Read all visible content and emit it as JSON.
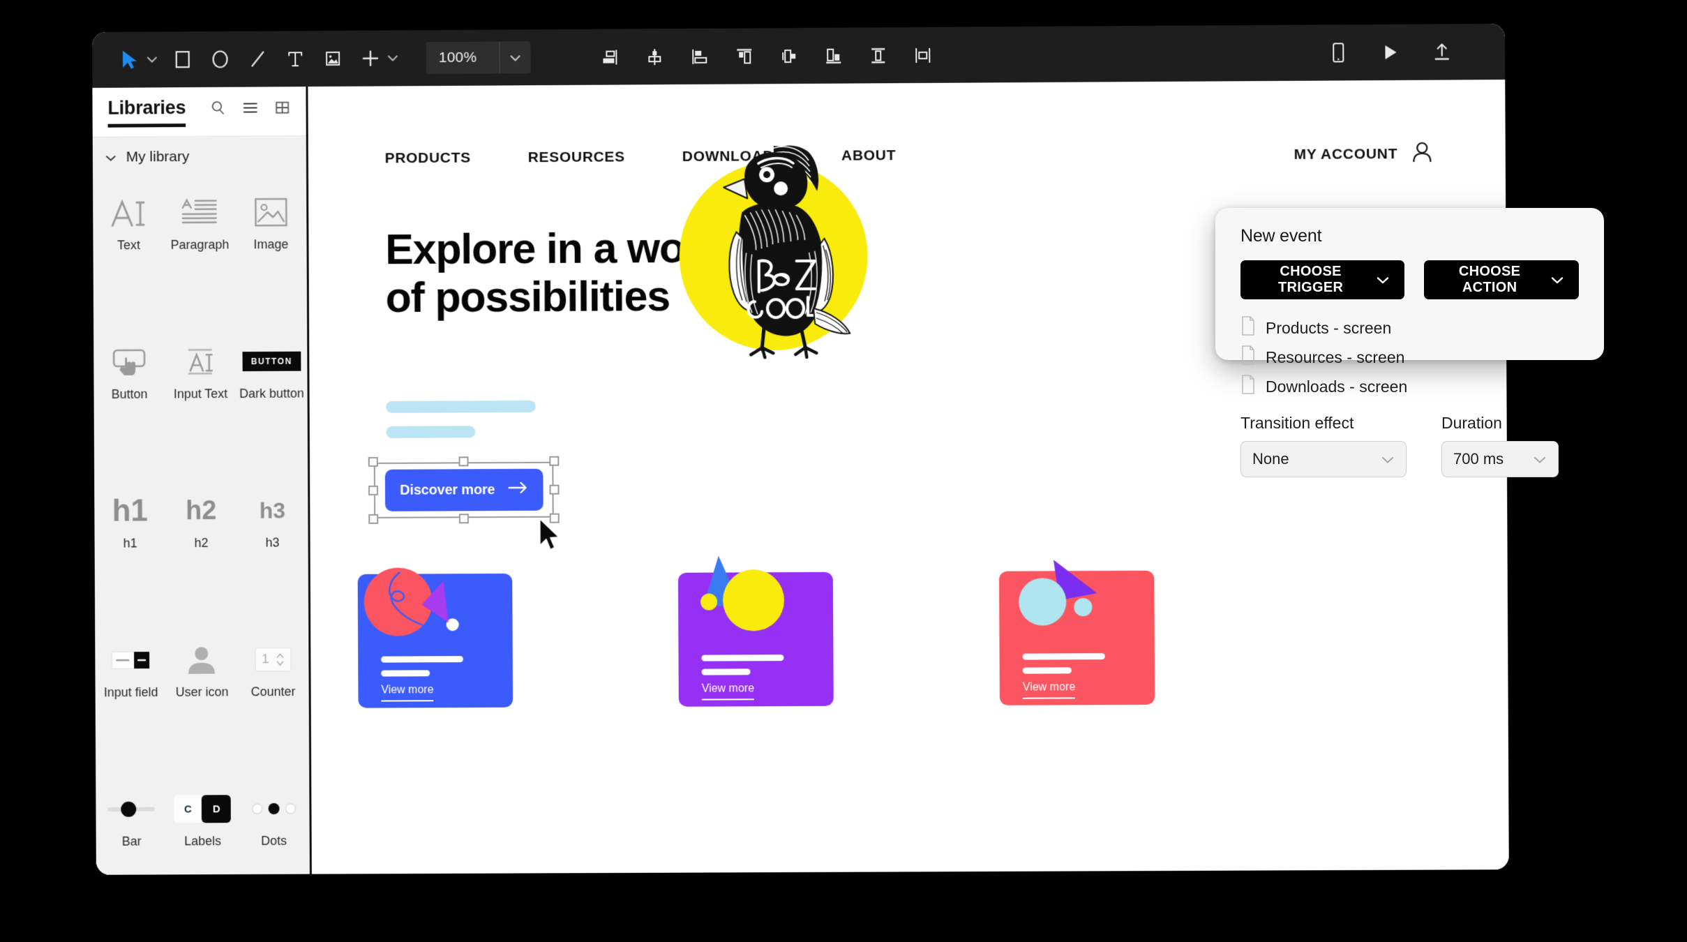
{
  "toolbar": {
    "tools": [
      {
        "name": "select-tool",
        "icon": "cursor-arrow-icon",
        "has_chevron": true,
        "active": true
      },
      {
        "name": "rectangle-tool",
        "icon": "rectangle-icon"
      },
      {
        "name": "ellipse-tool",
        "icon": "ellipse-icon"
      },
      {
        "name": "line-tool",
        "icon": "line-icon"
      },
      {
        "name": "text-tool",
        "icon": "text-t-icon"
      },
      {
        "name": "image-tool",
        "icon": "image-icon"
      },
      {
        "name": "add-tool",
        "icon": "plus-icon",
        "has_chevron": true
      }
    ],
    "zoom": {
      "value": "100%",
      "chevron": "chevron-down-icon"
    },
    "align_tools": [
      "align-right-icon",
      "align-center-horizontal-icon",
      "align-left-icon",
      "align-top-icon",
      "distribute-horizontal-icon",
      "align-bottom-icon",
      "align-middle-vertical-icon",
      "distribute-vertical-icon"
    ],
    "right_tools": [
      "mobile-preview-icon",
      "play-preview-icon",
      "export-upload-icon"
    ],
    "accent_color": "#1f8cf0",
    "background_color": "#1e1e1e"
  },
  "left_panel": {
    "title": "Libraries",
    "header_icons": [
      "search-icon",
      "list-view-icon",
      "grid-view-icon"
    ],
    "section": {
      "label": "My library",
      "chevron": "chevron-down-icon",
      "expanded": true
    },
    "items": [
      {
        "label": "Text",
        "icon": "text-ai-icon"
      },
      {
        "label": "Paragraph",
        "icon": "paragraph-icon"
      },
      {
        "label": "Image",
        "icon": "image-placeholder-icon"
      },
      {
        "label": "Button",
        "icon": "button-tap-icon"
      },
      {
        "label": "Input Text",
        "icon": "input-text-icon"
      },
      {
        "label": "Dark button",
        "icon": "dark-button-icon",
        "chip_text": "BUTTON"
      },
      {
        "label": "h1",
        "icon": "heading-h1-icon",
        "glyph": "h1"
      },
      {
        "label": "h2",
        "icon": "heading-h2-icon",
        "glyph": "h2"
      },
      {
        "label": "h3",
        "icon": "heading-h3-icon",
        "glyph": "h3"
      },
      {
        "label": "Input field",
        "icon": "input-field-icon"
      },
      {
        "label": "User icon",
        "icon": "user-avatar-icon"
      },
      {
        "label": "Counter",
        "icon": "counter-icon",
        "value": "1"
      },
      {
        "label": "Bar",
        "icon": "slider-bar-icon"
      },
      {
        "label": "Labels",
        "icon": "labels-toggle-icon",
        "chip_a": "C",
        "chip_b": "D"
      },
      {
        "label": "Dots",
        "icon": "dots-pagination-icon"
      }
    ]
  },
  "canvas": {
    "nav": [
      "PRODUCTS",
      "RESOURCES",
      "DOWNLOADS",
      "ABOUT"
    ],
    "account": {
      "label": "MY ACCOUNT",
      "icon": "user-account-icon"
    },
    "hero": {
      "title": "Explore in a world\nof possibilities",
      "cta": {
        "label": "Discover more",
        "icon": "arrow-right-icon",
        "color": "#3b5bfd",
        "selected": true
      }
    },
    "illustration": {
      "name": "bird-be-cool-illustration",
      "text": "Be Cool",
      "circle_color": "#f9ec0d"
    },
    "cards": [
      {
        "link": "View more",
        "bg": "#3b5bfd",
        "shape_circle": "#fa5560",
        "shape_triangle": "#a63bf0"
      },
      {
        "link": "View more",
        "bg": "#9630f5",
        "shape_circle": "#f9ec0d",
        "shape_triangle": "#3b7bf0"
      },
      {
        "link": "View more",
        "bg": "#fa5560",
        "shape_circle": "#aee5f0",
        "shape_triangle": "#7b2df0"
      }
    ]
  },
  "event_panel": {
    "title": "New event",
    "trigger_button": {
      "label": "CHOOSE TRIGGER",
      "chevron": "chevron-down-icon"
    },
    "action_button": {
      "label": "CHOOSE ACTION",
      "chevron": "chevron-down-icon"
    },
    "screens": [
      {
        "label": "Products - screen",
        "icon": "file-page-icon"
      },
      {
        "label": "Resources - screen",
        "icon": "file-page-icon"
      },
      {
        "label": "Downloads  - screen",
        "icon": "file-page-icon"
      }
    ],
    "transition": {
      "label": "Transition effect",
      "value": "None",
      "chevron": "chevron-down-icon"
    },
    "duration": {
      "label": "Duration",
      "value": "700 ms",
      "chevron": "chevron-down-icon"
    }
  }
}
